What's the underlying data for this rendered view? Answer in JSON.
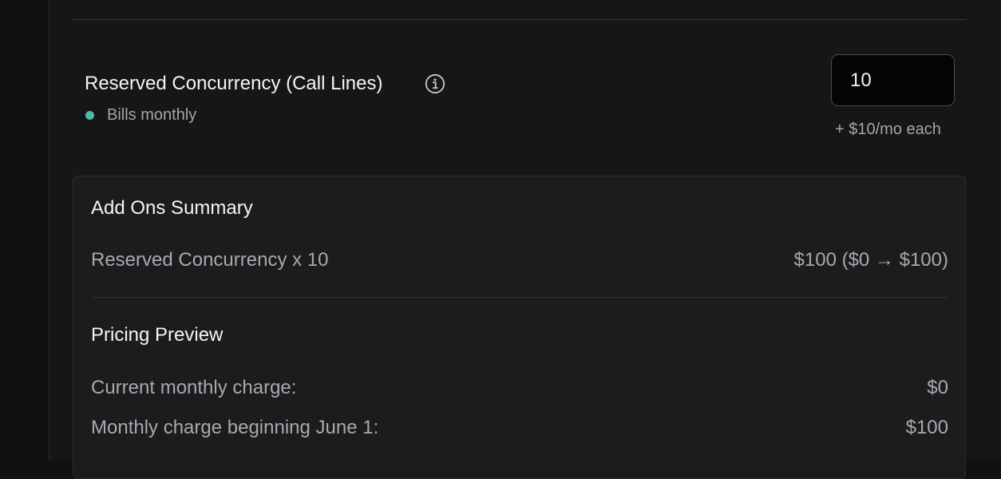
{
  "concurrency": {
    "title": "Reserved Concurrency (Call Lines)",
    "status_text": "Bills monthly",
    "status_color": "#4fb7a4",
    "quantity_value": "10",
    "price_note": "+ $10/mo each",
    "info_icon": "info-circle-icon"
  },
  "summary": {
    "title": "Add Ons Summary",
    "item_label": "Reserved Concurrency x 10",
    "item_value": "$100 ($0 → $100)"
  },
  "pricing": {
    "title": "Pricing Preview",
    "current_label": "Current monthly charge:",
    "current_value": "$0",
    "next_label": "Monthly charge beginning June 1:",
    "next_value": "$100"
  }
}
